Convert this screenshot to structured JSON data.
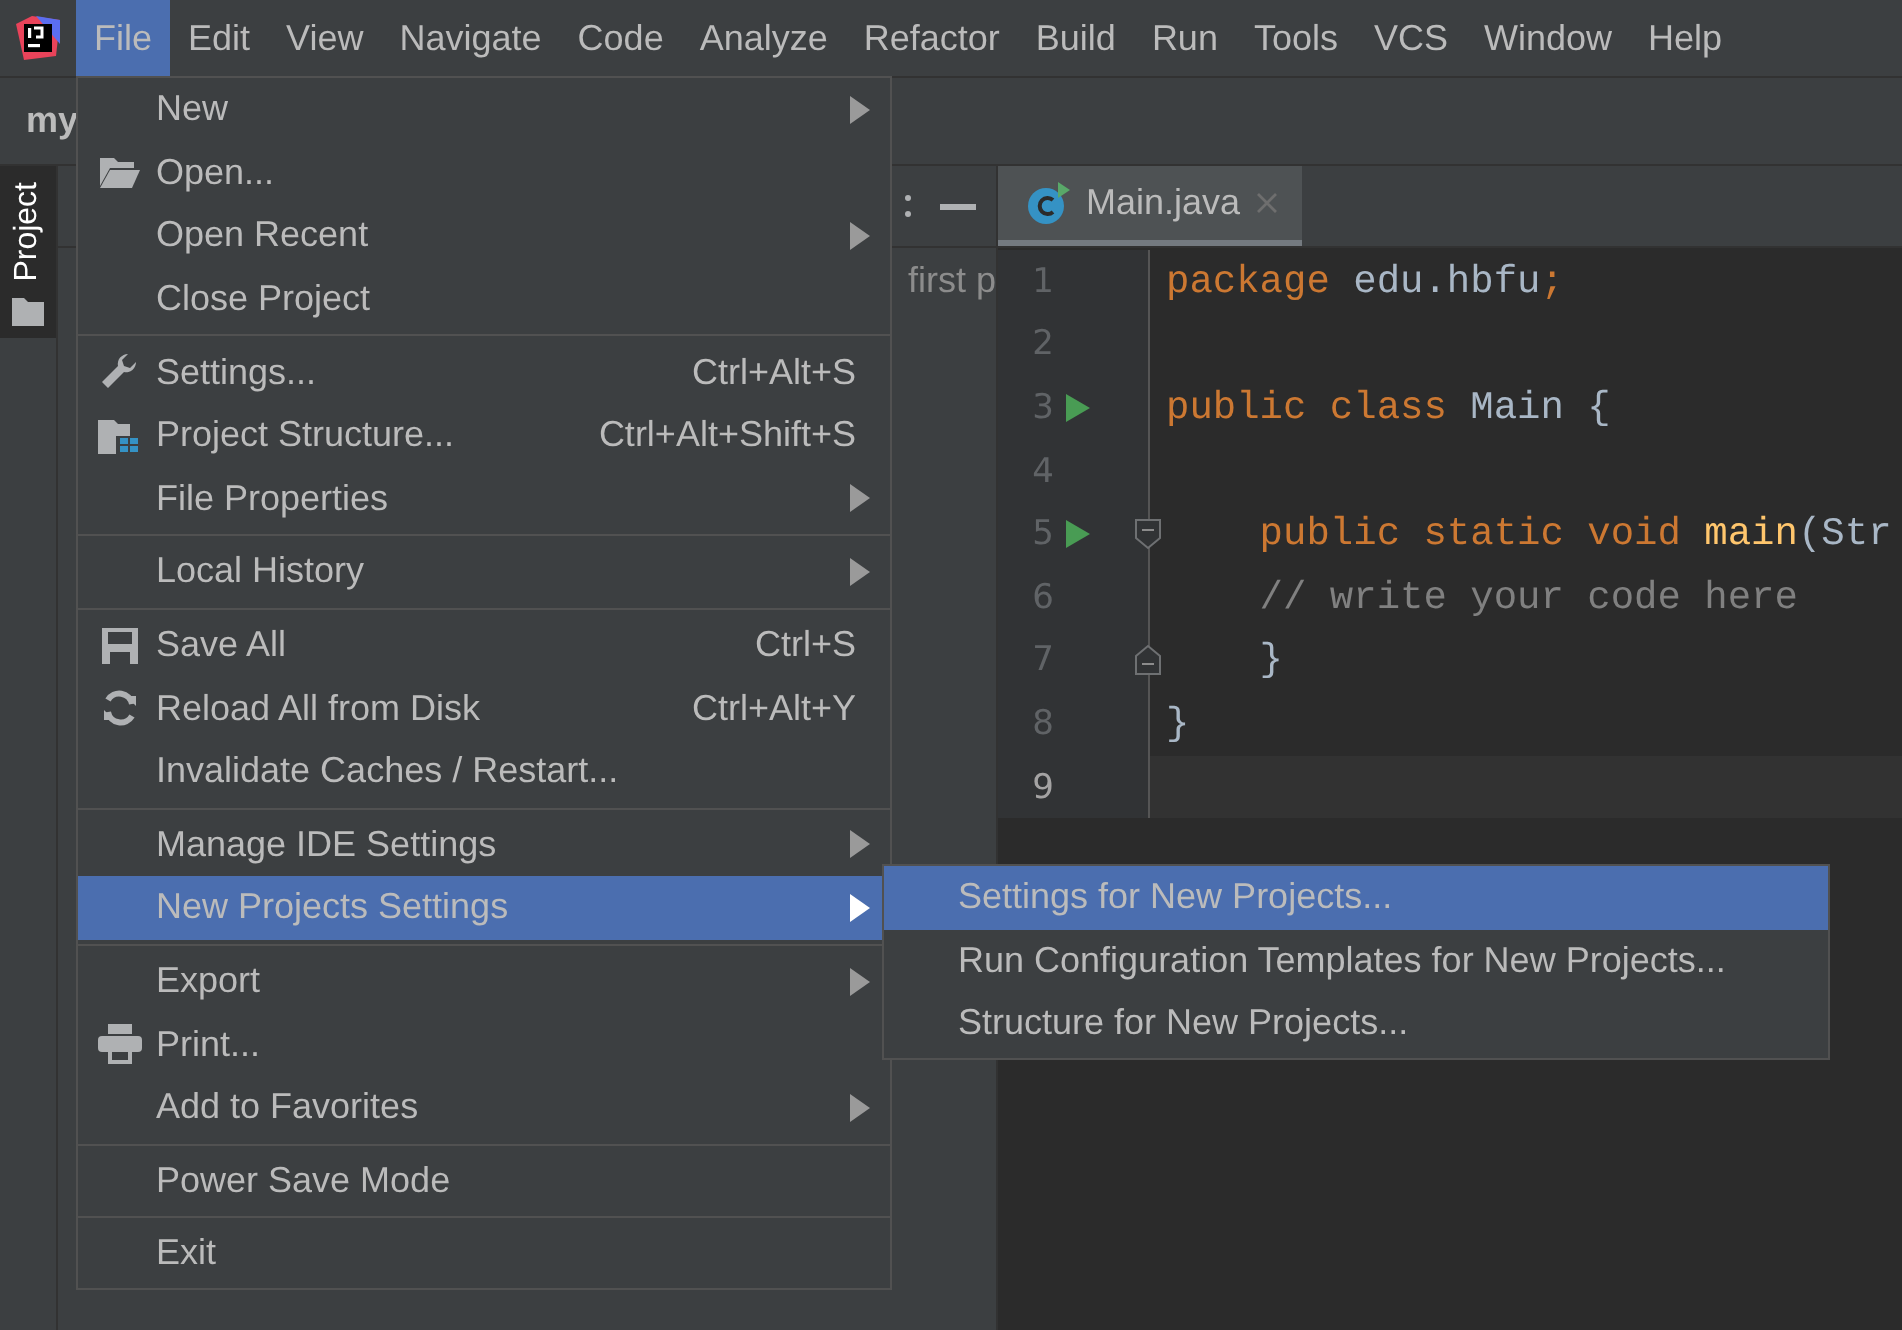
{
  "menubar": [
    {
      "label": "File",
      "selected": true
    },
    {
      "label": "Edit",
      "selected": false
    },
    {
      "label": "View",
      "selected": false
    },
    {
      "label": "Navigate",
      "selected": false
    },
    {
      "label": "Code",
      "selected": false
    },
    {
      "label": "Analyze",
      "selected": false
    },
    {
      "label": "Refactor",
      "selected": false
    },
    {
      "label": "Build",
      "selected": false
    },
    {
      "label": "Run",
      "selected": false
    },
    {
      "label": "Tools",
      "selected": false
    },
    {
      "label": "VCS",
      "selected": false
    },
    {
      "label": "Window",
      "selected": false
    },
    {
      "label": "Help",
      "selected": false
    }
  ],
  "nav_bar": {
    "project": "my"
  },
  "tool_stripe": [
    {
      "label": "Project",
      "selected": true
    }
  ],
  "project_panel": {
    "text": "first p"
  },
  "editor": {
    "tabs": [
      {
        "label": "Main.java",
        "selected": true
      }
    ],
    "lines": [
      {
        "number": "1",
        "tokens": [
          {
            "kind": "keyword",
            "text": "package "
          },
          {
            "kind": "plain",
            "text": "edu.hbfu"
          },
          {
            "kind": "keyword",
            "text": ";"
          }
        ]
      },
      {
        "number": "2"
      },
      {
        "number": "3",
        "run": true,
        "tokens": [
          {
            "kind": "keyword",
            "text": "public class "
          },
          {
            "kind": "plain",
            "text": "Main {"
          }
        ]
      },
      {
        "number": "4"
      },
      {
        "number": "5",
        "run": true,
        "fold_start": true,
        "tokens": [
          {
            "kind": "keyword",
            "text": "    public static void "
          },
          {
            "kind": "method",
            "text": "main"
          },
          {
            "kind": "plain",
            "text": "(Str"
          }
        ]
      },
      {
        "number": "6",
        "tokens": [
          {
            "kind": "comment",
            "text": "    // write your code here"
          }
        ]
      },
      {
        "number": "7",
        "fold_end": true,
        "tokens": [
          {
            "kind": "plain",
            "text": "    }"
          }
        ]
      },
      {
        "number": "8",
        "tokens": [
          {
            "kind": "plain",
            "text": "}"
          }
        ]
      },
      {
        "number": "9",
        "current": true
      }
    ]
  },
  "file_menu": [
    {
      "kind": "item",
      "label": "New",
      "submenu": true,
      "selected": false
    },
    {
      "kind": "item",
      "label": "Open...",
      "selected": false
    },
    {
      "kind": "item",
      "label": "Open Recent",
      "submenu": true,
      "selected": false
    },
    {
      "kind": "item",
      "label": "Close Project",
      "selected": false
    },
    {
      "kind": "separator"
    },
    {
      "kind": "item",
      "label": "Settings...",
      "shortcut": "Ctrl+Alt+S",
      "selected": false
    },
    {
      "kind": "item",
      "label": "Project Structure...",
      "shortcut": "Ctrl+Alt+Shift+S",
      "selected": false
    },
    {
      "kind": "item",
      "label": "File Properties",
      "submenu": true,
      "selected": false
    },
    {
      "kind": "separator"
    },
    {
      "kind": "item",
      "label": "Local History",
      "submenu": true,
      "selected": false
    },
    {
      "kind": "separator"
    },
    {
      "kind": "item",
      "label": "Save All",
      "shortcut": "Ctrl+S",
      "selected": false
    },
    {
      "kind": "item",
      "label": "Reload All from Disk",
      "shortcut": "Ctrl+Alt+Y",
      "selected": false
    },
    {
      "kind": "item",
      "label": "Invalidate Caches / Restart...",
      "selected": false
    },
    {
      "kind": "separator"
    },
    {
      "kind": "item",
      "label": "Manage IDE Settings",
      "submenu": true,
      "selected": false
    },
    {
      "kind": "item",
      "label": "New Projects Settings",
      "submenu": true,
      "selected": true,
      "children": [
        {
          "label": "Settings for New Projects...",
          "selected": true
        },
        {
          "label": "Run Configuration Templates for New Projects...",
          "selected": false
        },
        {
          "label": "Structure for New Projects...",
          "selected": false
        }
      ]
    },
    {
      "kind": "separator"
    },
    {
      "kind": "item",
      "label": "Export",
      "submenu": true,
      "selected": false
    },
    {
      "kind": "item",
      "label": "Print...",
      "selected": false
    },
    {
      "kind": "item",
      "label": "Add to Favorites",
      "submenu": true,
      "selected": false
    },
    {
      "kind": "separator"
    },
    {
      "kind": "item",
      "label": "Power Save Mode",
      "selected": false
    },
    {
      "kind": "separator"
    },
    {
      "kind": "item",
      "label": "Exit",
      "selected": false
    }
  ]
}
